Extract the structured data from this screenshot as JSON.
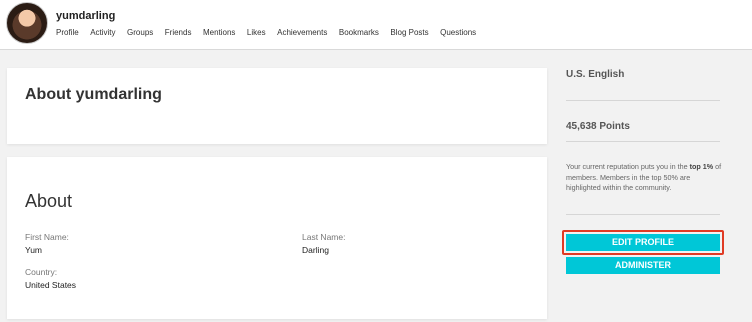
{
  "header": {
    "username": "yumdarling",
    "nav": [
      "Profile",
      "Activity",
      "Groups",
      "Friends",
      "Mentions",
      "Likes",
      "Achievements",
      "Bookmarks",
      "Blog Posts",
      "Questions"
    ]
  },
  "main": {
    "card_title": "About yumdarling",
    "about_heading": "About",
    "fields": {
      "first_name_label": "First Name:",
      "first_name_value": "Yum",
      "last_name_label": "Last Name:",
      "last_name_value": "Darling",
      "country_label": "Country:",
      "country_value": "United States"
    }
  },
  "sidebar": {
    "language": "U.S. English",
    "points": "45,638 Points",
    "reputation_pre": "Your current reputation puts you in the ",
    "reputation_bold": "top 1%",
    "reputation_post": " of members. Members in the top 50% are highlighted within the community.",
    "edit_button": "EDIT PROFILE",
    "admin_button": "ADMINISTER"
  },
  "colors": {
    "accent": "#00c7d7",
    "highlight": "#e03b24"
  }
}
